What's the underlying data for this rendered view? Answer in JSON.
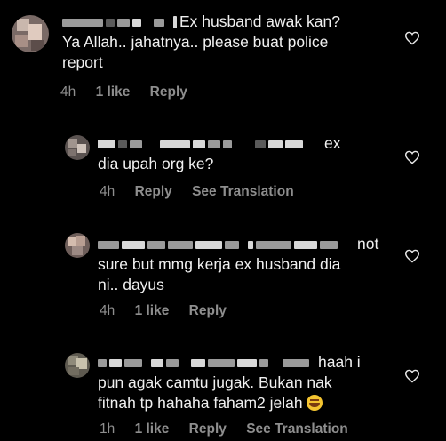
{
  "comments": [
    {
      "text_line1": "Ex husband awak kan?",
      "text_line2": "Ya Allah.. jahatnya.. please buat police",
      "text_line3": "report",
      "time": "4h",
      "likes": "1 like",
      "reply": "Reply"
    },
    {
      "text_line1": "ex",
      "text_line2": "dia upah org ke?",
      "time": "4h",
      "reply": "Reply",
      "see_translation": "See Translation"
    },
    {
      "text_line1": "not",
      "text_line2": "sure but mmg kerja ex husband dia",
      "text_line3": "ni.. dayus",
      "time": "4h",
      "likes": "1 like",
      "reply": "Reply"
    },
    {
      "text_line1": "haah i",
      "text_line2": "pun agak camtu jugak. Bukan nak",
      "text_line3": "fitnah tp hahaha faham2 jelah",
      "emoji_icon": "grinning-sweat-emoji",
      "time": "1h",
      "likes": "1 like",
      "reply": "Reply",
      "see_translation": "See Translation"
    }
  ],
  "colors": {
    "background": "#000000",
    "text": "#f0f0f0",
    "meta": "#8e8e8e"
  },
  "icons": [
    "heart-outline-icon",
    "avatar-pixelated"
  ]
}
